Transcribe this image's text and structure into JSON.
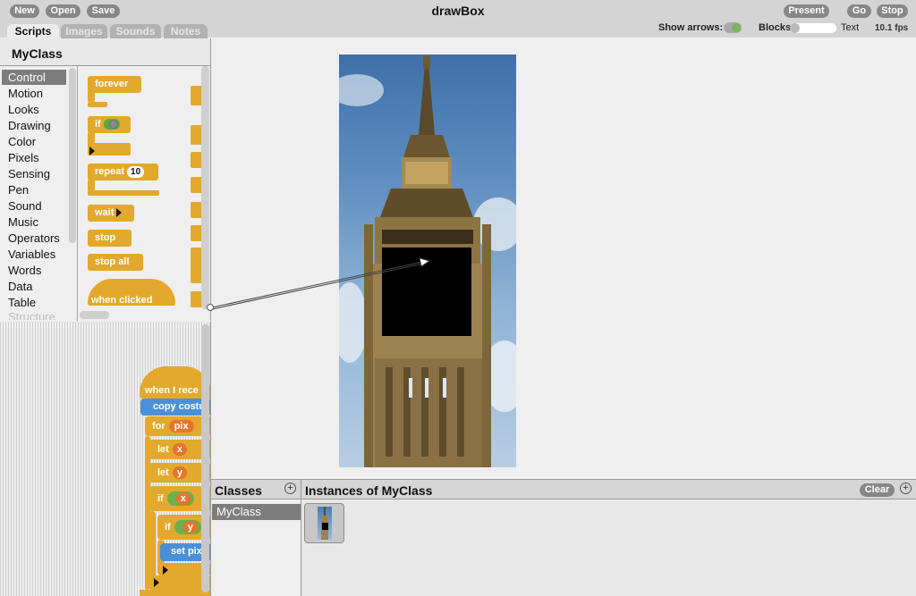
{
  "toolbar": {
    "new_label": "New",
    "open_label": "Open",
    "save_label": "Save",
    "title": "drawBox",
    "present_label": "Present",
    "go_label": "Go",
    "stop_label": "Stop",
    "show_arrows_label": "Show arrows:",
    "show_arrows_on": true,
    "blocks_label": "Blocks",
    "text_label": "Text",
    "fps": "10.1 fps"
  },
  "tabs": [
    {
      "label": "Scripts",
      "active": true
    },
    {
      "label": "Images",
      "active": false
    },
    {
      "label": "Sounds",
      "active": false
    },
    {
      "label": "Notes",
      "active": false
    }
  ],
  "palette": {
    "class_name": "MyClass",
    "categories": [
      "Control",
      "Motion",
      "Looks",
      "Drawing",
      "Color",
      "Pixels",
      "Sensing",
      "Pen",
      "Sound",
      "Music",
      "Operators",
      "Variables",
      "Words",
      "Data",
      "Table",
      "Structure"
    ],
    "selected_category": "Control",
    "blocks": {
      "forever": "forever",
      "if": "if",
      "repeat": "repeat",
      "repeat_count": "10",
      "wait": "wait",
      "stop": "stop",
      "stop_all": "stop all",
      "when_clicked": "when clicked"
    }
  },
  "script": {
    "hat": "when I rece",
    "copy": "copy costu",
    "for_label": "for",
    "for_var": "pix",
    "let1": "let",
    "let1_var": "x",
    "let2": "let",
    "let2_var": "y",
    "if1": "if",
    "if1_var": "x",
    "if2": "if",
    "if2_var": "y",
    "set": "set pix"
  },
  "classes_panel": {
    "title": "Classes",
    "items": [
      "MyClass"
    ]
  },
  "instances_panel": {
    "title": "Instances of MyClass",
    "clear_label": "Clear"
  },
  "colors": {
    "control_block": "#e3a92d",
    "looks_block": "#4a90d9",
    "variable_slot": "#e4752d",
    "boolean_slot": "#6ab04c",
    "selected_row": "#7d7d7d"
  }
}
